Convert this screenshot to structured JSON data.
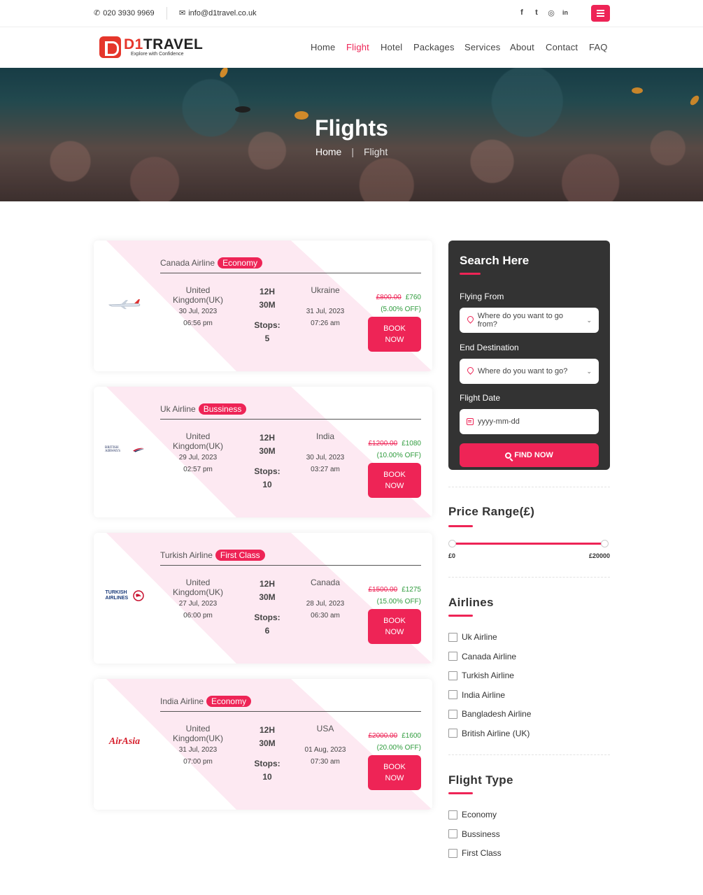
{
  "topbar": {
    "phone": "020 3930 9969",
    "email": "info@d1travel.co.uk",
    "social": [
      {
        "icon": "facebook-icon",
        "glyph": "f"
      },
      {
        "icon": "twitter-icon",
        "glyph": "t"
      },
      {
        "icon": "instagram-icon",
        "glyph": "◎"
      },
      {
        "icon": "linkedin-icon",
        "glyph": "in"
      }
    ]
  },
  "brand": {
    "name_part1": "D1",
    "name_part2": "TRAVEL",
    "tagline": "Explore with Confidence",
    "accent": "#ee2456",
    "logo_red": "#e5362b"
  },
  "nav": {
    "items": [
      "Home",
      "Flight",
      "Hotel",
      "Packages",
      "Services",
      "About",
      "Contact",
      "FAQ"
    ],
    "active": "Flight"
  },
  "hero": {
    "title": "Flights",
    "crumb_home": "Home",
    "crumb_sep": "|",
    "crumb_current": "Flight"
  },
  "flights": [
    {
      "airline": "Canada Airline",
      "class": "Economy",
      "logo_icon": "airplane-image",
      "from": "United Kingdom(UK)",
      "from_date": "30 Jul, 2023",
      "from_time": "06:56 pm",
      "duration_h": "12H",
      "duration_m": "30M",
      "stops_label": "Stops:",
      "stops": "5",
      "to": "Ukraine",
      "to_date": "31 Jul, 2023",
      "to_time": "07:26 am",
      "old_price": "£800.00",
      "new_price": "£760",
      "discount": "(5.00% OFF)",
      "book_label": "BOOK NOW"
    },
    {
      "airline": "Uk Airline",
      "class": "Bussiness",
      "logo_icon": "british-airways-logo",
      "logo_text": "BRITISH AIRWAYS",
      "from": "United Kingdom(UK)",
      "from_date": "29 Jul, 2023",
      "from_time": "02:57 pm",
      "duration_h": "12H",
      "duration_m": "30M",
      "stops_label": "Stops:",
      "stops": "10",
      "to": "India",
      "to_date": "30 Jul, 2023",
      "to_time": "03:27 am",
      "old_price": "£1200.00",
      "new_price": "£1080",
      "discount": "(10.00% OFF)",
      "book_label": "BOOK NOW"
    },
    {
      "airline": "Turkish Airline",
      "class": "First Class",
      "logo_icon": "turkish-airlines-logo",
      "logo_text": "TURKISH AIRLINES",
      "from": "United Kingdom(UK)",
      "from_date": "27 Jul, 2023",
      "from_time": "06:00 pm",
      "duration_h": "12H",
      "duration_m": "30M",
      "stops_label": "Stops:",
      "stops": "6",
      "to": "Canada",
      "to_date": "28 Jul, 2023",
      "to_time": "06:30 am",
      "old_price": "£1500.00",
      "new_price": "£1275",
      "discount": "(15.00% OFF)",
      "book_label": "BOOK NOW"
    },
    {
      "airline": "India Airline",
      "class": "Economy",
      "logo_icon": "airasia-logo",
      "logo_text": "AirAsia",
      "from": "United Kingdom(UK)",
      "from_date": "31 Jul, 2023",
      "from_time": "07:00 pm",
      "duration_h": "12H",
      "duration_m": "30M",
      "stops_label": "Stops:",
      "stops": "10",
      "to": "USA",
      "to_date": "01 Aug, 2023",
      "to_time": "07:30 am",
      "old_price": "£2000.00",
      "new_price": "£1600",
      "discount": "(20.00% OFF)",
      "book_label": "BOOK NOW"
    }
  ],
  "search": {
    "title": "Search Here",
    "from_label": "Flying From",
    "from_placeholder": "Where do you want to go from?",
    "to_label": "End Destination",
    "to_placeholder": "Where do you want to go?",
    "date_label": "Flight Date",
    "date_placeholder": "yyyy-mm-dd",
    "find_label": "FIND NOW"
  },
  "price_range": {
    "title": "Price Range(£)",
    "min_label": "£0",
    "max_label": "£20000",
    "selected_min_fraction": 0,
    "selected_max_fraction": 1
  },
  "airlines_filter": {
    "title": "Airlines",
    "options": [
      "Uk Airline",
      "Canada Airline",
      "Turkish Airline",
      "India Airline",
      "Bangladesh Airline",
      "British Airline (UK)"
    ]
  },
  "flight_type_filter": {
    "title": "Flight Type",
    "options": [
      "Economy",
      "Bussiness",
      "First Class"
    ]
  }
}
